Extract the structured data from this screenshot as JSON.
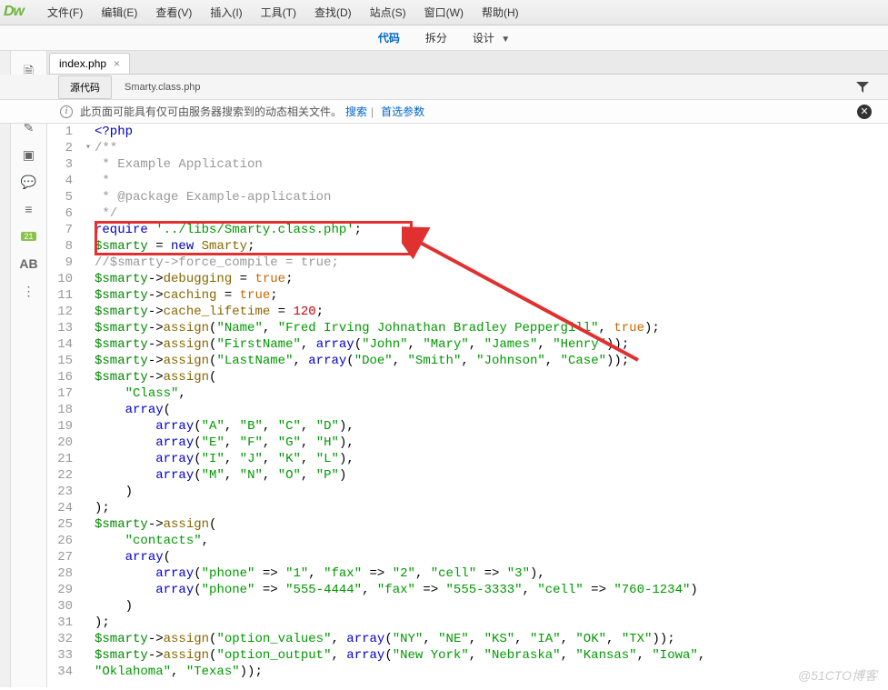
{
  "logo": "Dw",
  "menubar": [
    "文件(F)",
    "编辑(E)",
    "查看(V)",
    "插入(I)",
    "工具(T)",
    "查找(D)",
    "站点(S)",
    "窗口(W)",
    "帮助(H)"
  ],
  "viewbar": {
    "code": "代码",
    "split": "拆分",
    "design": "设计"
  },
  "tab": {
    "name": "index.php",
    "close": "×"
  },
  "subtabs": {
    "source": "源代码",
    "file": "Smarty.class.php"
  },
  "infobar": {
    "text": "此页面可能具有仅可由服务器搜索到的动态相关文件。",
    "link1": "搜索",
    "link2": "首选参数"
  },
  "left_badge": "21",
  "watermark": "@51CTO博客",
  "code": [
    {
      "n": 1,
      "f": "",
      "tokens": [
        {
          "t": "<?php",
          "c": "c-blue"
        }
      ]
    },
    {
      "n": 2,
      "f": "▾",
      "tokens": [
        {
          "t": "/**",
          "c": "c-cmt"
        }
      ]
    },
    {
      "n": 3,
      "f": "",
      "tokens": [
        {
          "t": " * Example Application",
          "c": "c-cmt"
        }
      ]
    },
    {
      "n": 4,
      "f": "",
      "tokens": [
        {
          "t": " *",
          "c": "c-cmt"
        }
      ]
    },
    {
      "n": 5,
      "f": "",
      "tokens": [
        {
          "t": " * @package Example-application",
          "c": "c-cmt"
        }
      ]
    },
    {
      "n": 6,
      "f": "",
      "tokens": [
        {
          "t": " */",
          "c": "c-cmt"
        }
      ]
    },
    {
      "n": 7,
      "f": "",
      "tokens": [
        {
          "t": "require ",
          "c": "c-blue"
        },
        {
          "t": "'../libs/Smarty.class.php'",
          "c": "c-str"
        },
        {
          "t": ";",
          "c": ""
        }
      ]
    },
    {
      "n": 8,
      "f": "",
      "tokens": [
        {
          "t": "$smarty",
          "c": "c-green"
        },
        {
          "t": " = ",
          "c": ""
        },
        {
          "t": "new",
          "c": "c-blue"
        },
        {
          "t": " ",
          "c": ""
        },
        {
          "t": "Smarty",
          "c": "c-brown"
        },
        {
          "t": ";",
          "c": ""
        }
      ]
    },
    {
      "n": 9,
      "f": "",
      "tokens": [
        {
          "t": "//$smarty->force_compile = true;",
          "c": "c-cmt"
        }
      ]
    },
    {
      "n": 10,
      "f": "",
      "tokens": [
        {
          "t": "$smarty",
          "c": "c-green"
        },
        {
          "t": "->",
          "c": ""
        },
        {
          "t": "debugging",
          "c": "c-brown"
        },
        {
          "t": " = ",
          "c": ""
        },
        {
          "t": "true",
          "c": "c-bool"
        },
        {
          "t": ";",
          "c": ""
        }
      ]
    },
    {
      "n": 11,
      "f": "",
      "tokens": [
        {
          "t": "$smarty",
          "c": "c-green"
        },
        {
          "t": "->",
          "c": ""
        },
        {
          "t": "caching",
          "c": "c-brown"
        },
        {
          "t": " = ",
          "c": ""
        },
        {
          "t": "true",
          "c": "c-bool"
        },
        {
          "t": ";",
          "c": ""
        }
      ]
    },
    {
      "n": 12,
      "f": "",
      "tokens": [
        {
          "t": "$smarty",
          "c": "c-green"
        },
        {
          "t": "->",
          "c": ""
        },
        {
          "t": "cache_lifetime",
          "c": "c-brown"
        },
        {
          "t": " = ",
          "c": ""
        },
        {
          "t": "120",
          "c": "c-num"
        },
        {
          "t": ";",
          "c": ""
        }
      ]
    },
    {
      "n": 13,
      "f": "",
      "tokens": [
        {
          "t": "$smarty",
          "c": "c-green"
        },
        {
          "t": "->",
          "c": ""
        },
        {
          "t": "assign",
          "c": "c-brown"
        },
        {
          "t": "(",
          "c": ""
        },
        {
          "t": "\"Name\"",
          "c": "c-str"
        },
        {
          "t": ", ",
          "c": ""
        },
        {
          "t": "\"Fred Irving Johnathan Bradley Peppergill\"",
          "c": "c-str"
        },
        {
          "t": ", ",
          "c": ""
        },
        {
          "t": "true",
          "c": "c-bool"
        },
        {
          "t": ");",
          "c": ""
        }
      ]
    },
    {
      "n": 14,
      "f": "",
      "tokens": [
        {
          "t": "$smarty",
          "c": "c-green"
        },
        {
          "t": "->",
          "c": ""
        },
        {
          "t": "assign",
          "c": "c-brown"
        },
        {
          "t": "(",
          "c": ""
        },
        {
          "t": "\"FirstName\"",
          "c": "c-str"
        },
        {
          "t": ", ",
          "c": ""
        },
        {
          "t": "array",
          "c": "c-blue"
        },
        {
          "t": "(",
          "c": ""
        },
        {
          "t": "\"John\"",
          "c": "c-str"
        },
        {
          "t": ", ",
          "c": ""
        },
        {
          "t": "\"Mary\"",
          "c": "c-str"
        },
        {
          "t": ", ",
          "c": ""
        },
        {
          "t": "\"James\"",
          "c": "c-str"
        },
        {
          "t": ", ",
          "c": ""
        },
        {
          "t": "\"Henry\"",
          "c": "c-str"
        },
        {
          "t": "));",
          "c": ""
        }
      ]
    },
    {
      "n": 15,
      "f": "",
      "tokens": [
        {
          "t": "$smarty",
          "c": "c-green"
        },
        {
          "t": "->",
          "c": ""
        },
        {
          "t": "assign",
          "c": "c-brown"
        },
        {
          "t": "(",
          "c": ""
        },
        {
          "t": "\"LastName\"",
          "c": "c-str"
        },
        {
          "t": ", ",
          "c": ""
        },
        {
          "t": "array",
          "c": "c-blue"
        },
        {
          "t": "(",
          "c": ""
        },
        {
          "t": "\"Doe\"",
          "c": "c-str"
        },
        {
          "t": ", ",
          "c": ""
        },
        {
          "t": "\"Smith\"",
          "c": "c-str"
        },
        {
          "t": ", ",
          "c": ""
        },
        {
          "t": "\"Johnson\"",
          "c": "c-str"
        },
        {
          "t": ", ",
          "c": ""
        },
        {
          "t": "\"Case\"",
          "c": "c-str"
        },
        {
          "t": "));",
          "c": ""
        }
      ]
    },
    {
      "n": 16,
      "f": "",
      "tokens": [
        {
          "t": "$smarty",
          "c": "c-green"
        },
        {
          "t": "->",
          "c": ""
        },
        {
          "t": "assign",
          "c": "c-brown"
        },
        {
          "t": "(",
          "c": ""
        }
      ]
    },
    {
      "n": 17,
      "f": "",
      "tokens": [
        {
          "t": "    ",
          "c": ""
        },
        {
          "t": "\"Class\"",
          "c": "c-str"
        },
        {
          "t": ",",
          "c": ""
        }
      ]
    },
    {
      "n": 18,
      "f": "",
      "tokens": [
        {
          "t": "    ",
          "c": ""
        },
        {
          "t": "array",
          "c": "c-blue"
        },
        {
          "t": "(",
          "c": ""
        }
      ]
    },
    {
      "n": 19,
      "f": "",
      "tokens": [
        {
          "t": "        ",
          "c": ""
        },
        {
          "t": "array",
          "c": "c-blue"
        },
        {
          "t": "(",
          "c": ""
        },
        {
          "t": "\"A\"",
          "c": "c-str"
        },
        {
          "t": ", ",
          "c": ""
        },
        {
          "t": "\"B\"",
          "c": "c-str"
        },
        {
          "t": ", ",
          "c": ""
        },
        {
          "t": "\"C\"",
          "c": "c-str"
        },
        {
          "t": ", ",
          "c": ""
        },
        {
          "t": "\"D\"",
          "c": "c-str"
        },
        {
          "t": "),",
          "c": ""
        }
      ]
    },
    {
      "n": 20,
      "f": "",
      "tokens": [
        {
          "t": "        ",
          "c": ""
        },
        {
          "t": "array",
          "c": "c-blue"
        },
        {
          "t": "(",
          "c": ""
        },
        {
          "t": "\"E\"",
          "c": "c-str"
        },
        {
          "t": ", ",
          "c": ""
        },
        {
          "t": "\"F\"",
          "c": "c-str"
        },
        {
          "t": ", ",
          "c": ""
        },
        {
          "t": "\"G\"",
          "c": "c-str"
        },
        {
          "t": ", ",
          "c": ""
        },
        {
          "t": "\"H\"",
          "c": "c-str"
        },
        {
          "t": "),",
          "c": ""
        }
      ]
    },
    {
      "n": 21,
      "f": "",
      "tokens": [
        {
          "t": "        ",
          "c": ""
        },
        {
          "t": "array",
          "c": "c-blue"
        },
        {
          "t": "(",
          "c": ""
        },
        {
          "t": "\"I\"",
          "c": "c-str"
        },
        {
          "t": ", ",
          "c": ""
        },
        {
          "t": "\"J\"",
          "c": "c-str"
        },
        {
          "t": ", ",
          "c": ""
        },
        {
          "t": "\"K\"",
          "c": "c-str"
        },
        {
          "t": ", ",
          "c": ""
        },
        {
          "t": "\"L\"",
          "c": "c-str"
        },
        {
          "t": "),",
          "c": ""
        }
      ]
    },
    {
      "n": 22,
      "f": "",
      "tokens": [
        {
          "t": "        ",
          "c": ""
        },
        {
          "t": "array",
          "c": "c-blue"
        },
        {
          "t": "(",
          "c": ""
        },
        {
          "t": "\"M\"",
          "c": "c-str"
        },
        {
          "t": ", ",
          "c": ""
        },
        {
          "t": "\"N\"",
          "c": "c-str"
        },
        {
          "t": ", ",
          "c": ""
        },
        {
          "t": "\"O\"",
          "c": "c-str"
        },
        {
          "t": ", ",
          "c": ""
        },
        {
          "t": "\"P\"",
          "c": "c-str"
        },
        {
          "t": ")",
          "c": ""
        }
      ]
    },
    {
      "n": 23,
      "f": "",
      "tokens": [
        {
          "t": "    )",
          "c": ""
        }
      ]
    },
    {
      "n": 24,
      "f": "",
      "tokens": [
        {
          "t": ");",
          "c": ""
        }
      ]
    },
    {
      "n": 25,
      "f": "",
      "tokens": [
        {
          "t": "$smarty",
          "c": "c-green"
        },
        {
          "t": "->",
          "c": ""
        },
        {
          "t": "assign",
          "c": "c-brown"
        },
        {
          "t": "(",
          "c": ""
        }
      ]
    },
    {
      "n": 26,
      "f": "",
      "tokens": [
        {
          "t": "    ",
          "c": ""
        },
        {
          "t": "\"contacts\"",
          "c": "c-str"
        },
        {
          "t": ",",
          "c": ""
        }
      ]
    },
    {
      "n": 27,
      "f": "",
      "tokens": [
        {
          "t": "    ",
          "c": ""
        },
        {
          "t": "array",
          "c": "c-blue"
        },
        {
          "t": "(",
          "c": ""
        }
      ]
    },
    {
      "n": 28,
      "f": "",
      "tokens": [
        {
          "t": "        ",
          "c": ""
        },
        {
          "t": "array",
          "c": "c-blue"
        },
        {
          "t": "(",
          "c": ""
        },
        {
          "t": "\"phone\"",
          "c": "c-str"
        },
        {
          "t": " => ",
          "c": ""
        },
        {
          "t": "\"1\"",
          "c": "c-str"
        },
        {
          "t": ", ",
          "c": ""
        },
        {
          "t": "\"fax\"",
          "c": "c-str"
        },
        {
          "t": " => ",
          "c": ""
        },
        {
          "t": "\"2\"",
          "c": "c-str"
        },
        {
          "t": ", ",
          "c": ""
        },
        {
          "t": "\"cell\"",
          "c": "c-str"
        },
        {
          "t": " => ",
          "c": ""
        },
        {
          "t": "\"3\"",
          "c": "c-str"
        },
        {
          "t": "),",
          "c": ""
        }
      ]
    },
    {
      "n": 29,
      "f": "",
      "tokens": [
        {
          "t": "        ",
          "c": ""
        },
        {
          "t": "array",
          "c": "c-blue"
        },
        {
          "t": "(",
          "c": ""
        },
        {
          "t": "\"phone\"",
          "c": "c-str"
        },
        {
          "t": " => ",
          "c": ""
        },
        {
          "t": "\"555-4444\"",
          "c": "c-str"
        },
        {
          "t": ", ",
          "c": ""
        },
        {
          "t": "\"fax\"",
          "c": "c-str"
        },
        {
          "t": " => ",
          "c": ""
        },
        {
          "t": "\"555-3333\"",
          "c": "c-str"
        },
        {
          "t": ", ",
          "c": ""
        },
        {
          "t": "\"cell\"",
          "c": "c-str"
        },
        {
          "t": " => ",
          "c": ""
        },
        {
          "t": "\"760-1234\"",
          "c": "c-str"
        },
        {
          "t": ")",
          "c": ""
        }
      ]
    },
    {
      "n": 30,
      "f": "",
      "tokens": [
        {
          "t": "    )",
          "c": ""
        }
      ]
    },
    {
      "n": 31,
      "f": "",
      "tokens": [
        {
          "t": ");",
          "c": ""
        }
      ]
    },
    {
      "n": 32,
      "f": "",
      "tokens": [
        {
          "t": "$smarty",
          "c": "c-green"
        },
        {
          "t": "->",
          "c": ""
        },
        {
          "t": "assign",
          "c": "c-brown"
        },
        {
          "t": "(",
          "c": ""
        },
        {
          "t": "\"option_values\"",
          "c": "c-str"
        },
        {
          "t": ", ",
          "c": ""
        },
        {
          "t": "array",
          "c": "c-blue"
        },
        {
          "t": "(",
          "c": ""
        },
        {
          "t": "\"NY\"",
          "c": "c-str"
        },
        {
          "t": ", ",
          "c": ""
        },
        {
          "t": "\"NE\"",
          "c": "c-str"
        },
        {
          "t": ", ",
          "c": ""
        },
        {
          "t": "\"KS\"",
          "c": "c-str"
        },
        {
          "t": ", ",
          "c": ""
        },
        {
          "t": "\"IA\"",
          "c": "c-str"
        },
        {
          "t": ", ",
          "c": ""
        },
        {
          "t": "\"OK\"",
          "c": "c-str"
        },
        {
          "t": ", ",
          "c": ""
        },
        {
          "t": "\"TX\"",
          "c": "c-str"
        },
        {
          "t": "));",
          "c": ""
        }
      ]
    },
    {
      "n": 33,
      "f": "",
      "tokens": [
        {
          "t": "$smarty",
          "c": "c-green"
        },
        {
          "t": "->",
          "c": ""
        },
        {
          "t": "assign",
          "c": "c-brown"
        },
        {
          "t": "(",
          "c": ""
        },
        {
          "t": "\"option_output\"",
          "c": "c-str"
        },
        {
          "t": ", ",
          "c": ""
        },
        {
          "t": "array",
          "c": "c-blue"
        },
        {
          "t": "(",
          "c": ""
        },
        {
          "t": "\"New York\"",
          "c": "c-str"
        },
        {
          "t": ", ",
          "c": ""
        },
        {
          "t": "\"Nebraska\"",
          "c": "c-str"
        },
        {
          "t": ", ",
          "c": ""
        },
        {
          "t": "\"Kansas\"",
          "c": "c-str"
        },
        {
          "t": ", ",
          "c": ""
        },
        {
          "t": "\"Iowa\"",
          "c": "c-str"
        },
        {
          "t": ",",
          "c": ""
        }
      ]
    },
    {
      "n": 34,
      "f": "",
      "tokens": [
        {
          "t": "\"Oklahoma\"",
          "c": "c-str"
        },
        {
          "t": ", ",
          "c": ""
        },
        {
          "t": "\"Texas\"",
          "c": "c-str"
        },
        {
          "t": "));",
          "c": ""
        }
      ]
    }
  ]
}
